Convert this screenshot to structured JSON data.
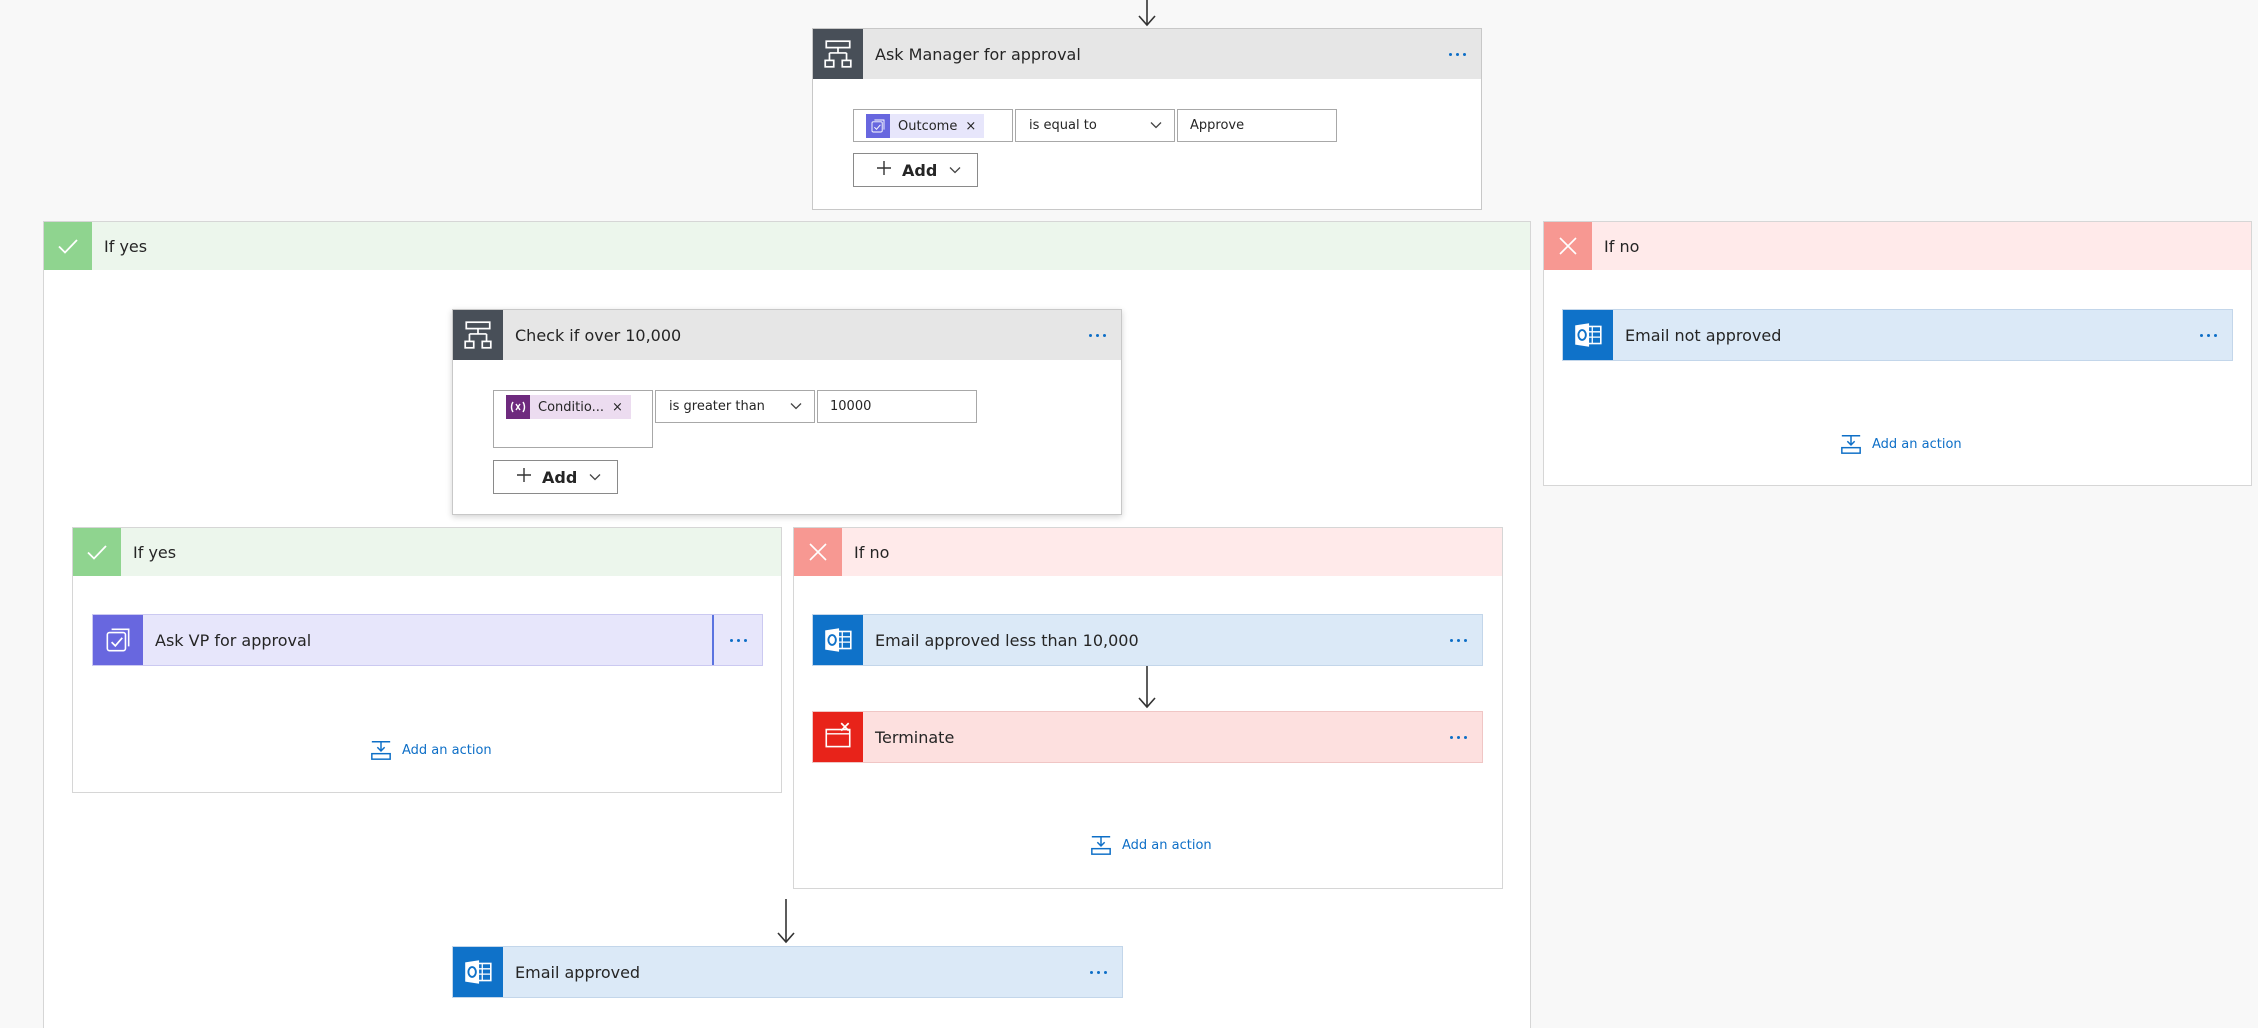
{
  "top_condition": {
    "title": "Ask Manager for approval",
    "token": "Outcome",
    "token_remove": "×",
    "operator": "is equal to",
    "value": "Approve",
    "add_label": "Add"
  },
  "outer_yes": {
    "label": "If yes",
    "nested_condition": {
      "title": "Check if over 10,000",
      "token": "Conditio...",
      "token_remove": "×",
      "operator": "is greater than",
      "value": "10000",
      "add_label": "Add"
    },
    "inner_yes": {
      "label": "If yes",
      "actions": [
        {
          "title": "Ask VP for approval"
        }
      ],
      "add_action": "Add an action"
    },
    "inner_no": {
      "label": "If no",
      "actions": [
        {
          "title": "Email approved less than 10,000"
        },
        {
          "title": "Terminate"
        }
      ],
      "add_action": "Add an action"
    },
    "final_action": {
      "title": "Email approved"
    }
  },
  "outer_no": {
    "label": "If no",
    "actions": [
      {
        "title": "Email not approved"
      }
    ],
    "add_action": "Add an action"
  },
  "colors": {
    "outlook": "#0f72c9",
    "approval": "#6867df",
    "terminate": "#e8231a",
    "yes": "#8fd48f",
    "no": "#f79892",
    "link": "#0e6fc7"
  },
  "icons": [
    "condition-icon",
    "approval-icon",
    "outlook-icon",
    "terminate-icon",
    "check-icon",
    "x-icon",
    "add-action-icon",
    "more-options-icon"
  ]
}
